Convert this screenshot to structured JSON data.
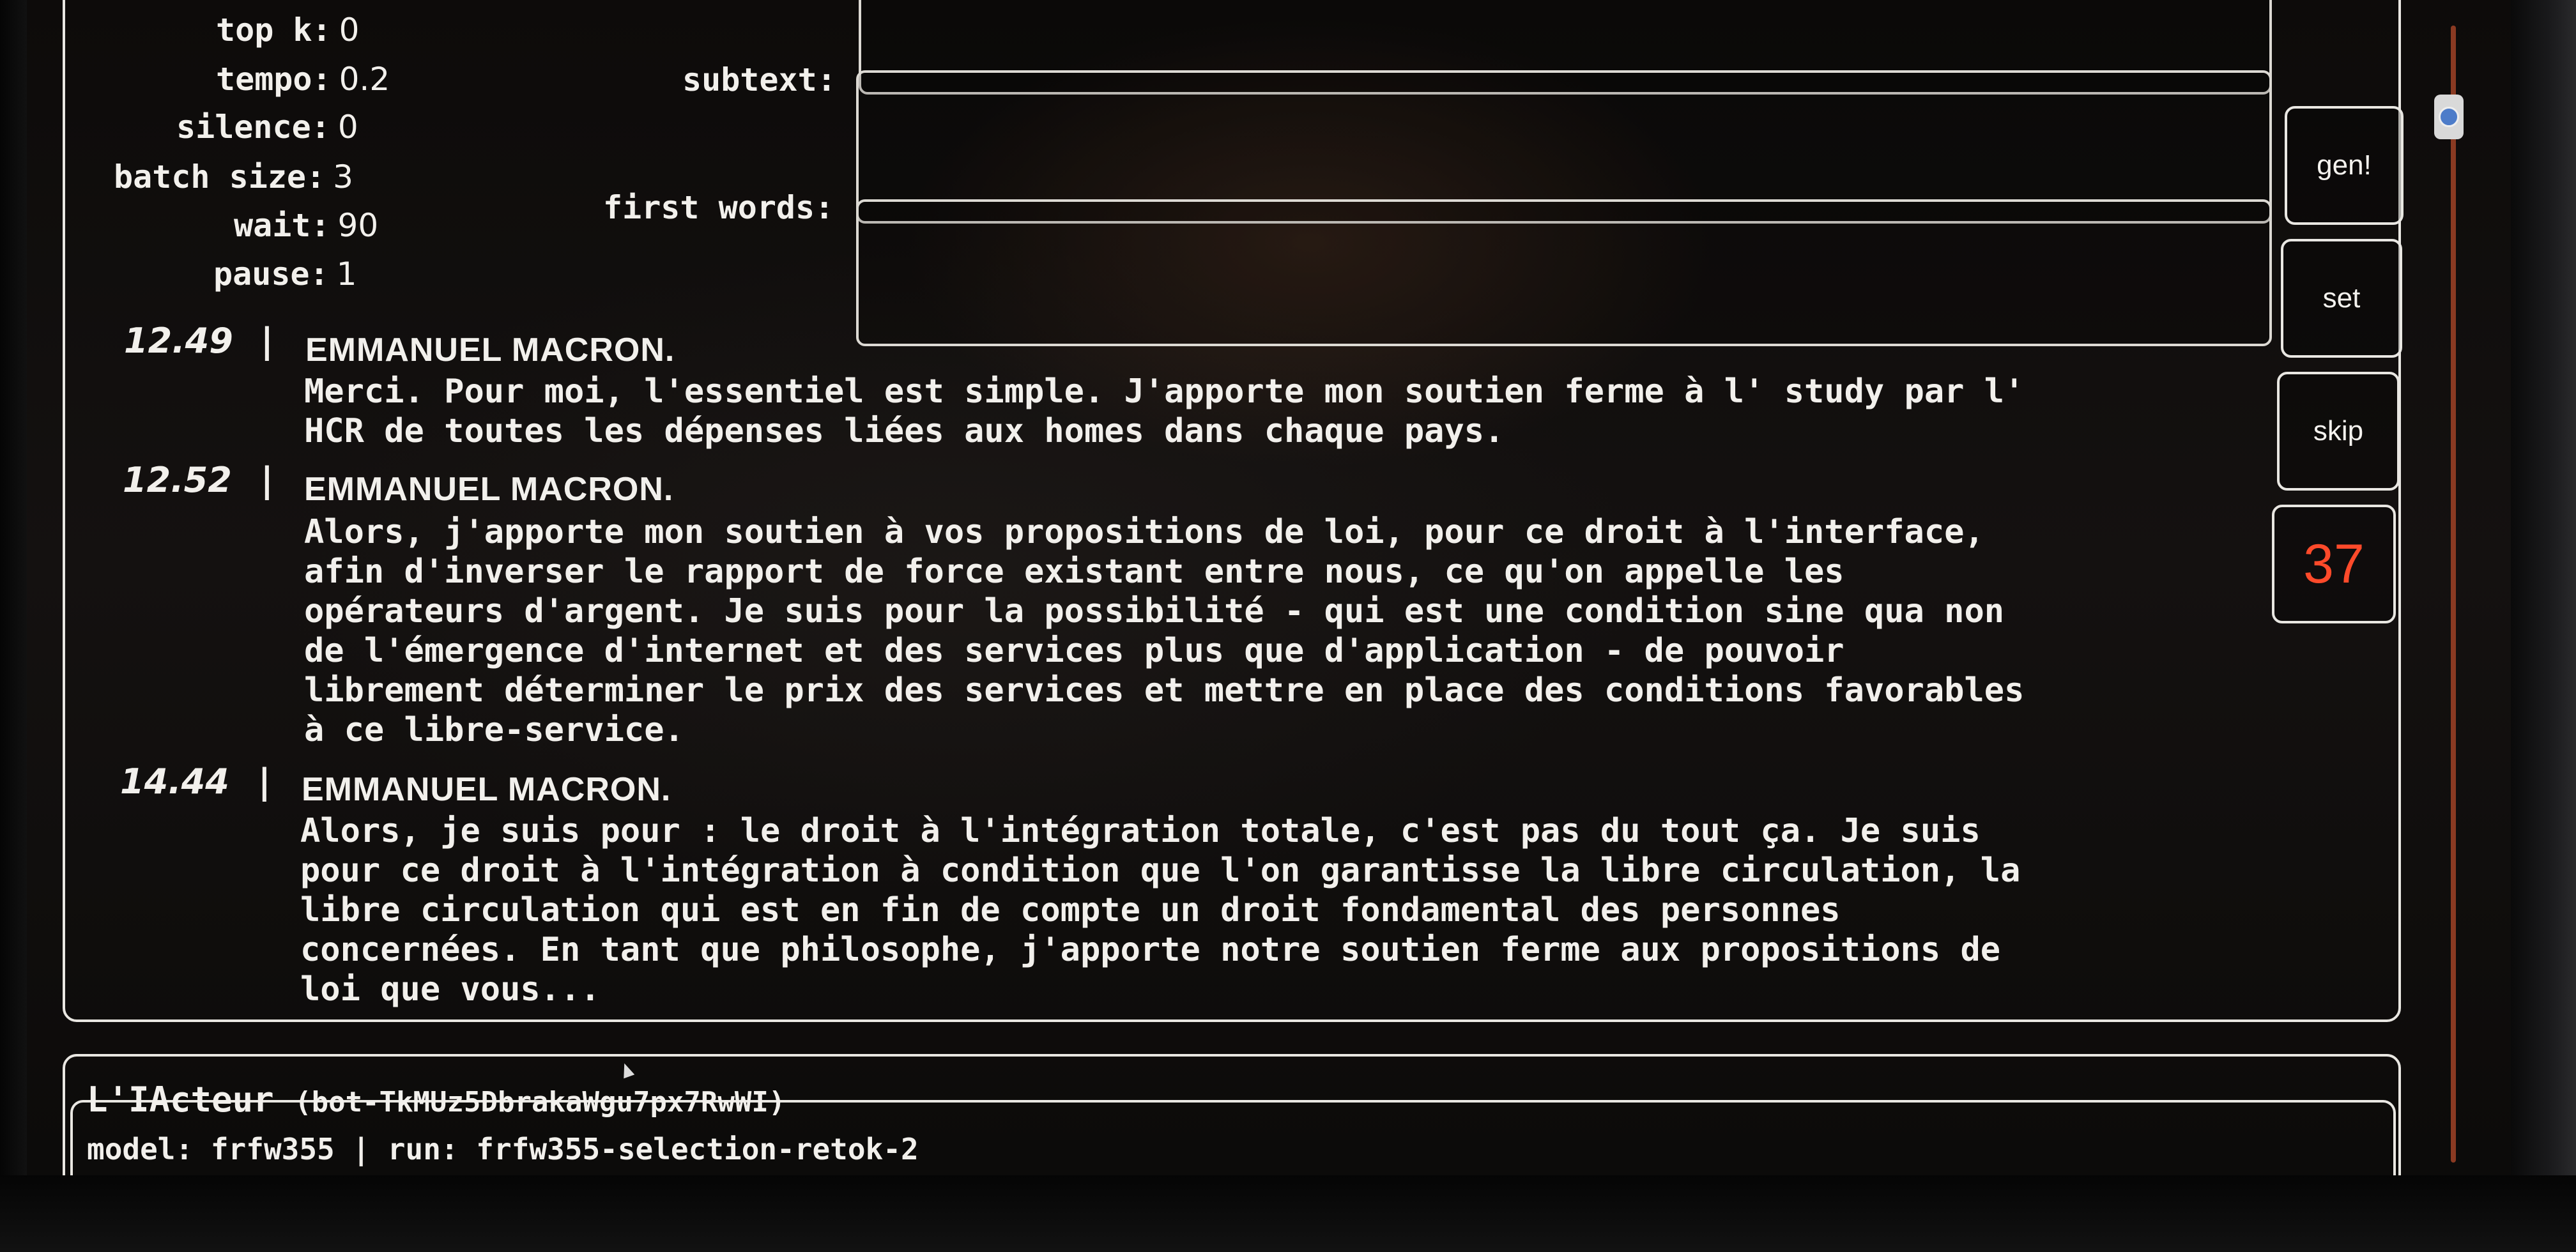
{
  "settings": [
    {
      "label": "top k:",
      "value": "0"
    },
    {
      "label": "tempo:",
      "value": "0.2"
    },
    {
      "label": "silence:",
      "value": "0"
    },
    {
      "label": "batch size:",
      "value": "3"
    },
    {
      "label": "wait:",
      "value": "90"
    },
    {
      "label": "pause:",
      "value": "1"
    }
  ],
  "fields": {
    "subtext_label": "subtext:",
    "first_words_label": "first words:"
  },
  "buttons": {
    "gen": "gen!",
    "set": "set",
    "skip": "skip",
    "counter": "37"
  },
  "transcript": [
    {
      "time": "12.49",
      "sep": "|",
      "speaker": "EMMANUEL MACRON.",
      "text": "Merci. Pour moi, l'essentiel est simple. J'apporte mon soutien ferme à l' study par l'\nHCR de toutes les dépenses liées aux homes dans chaque pays."
    },
    {
      "time": "12.52",
      "sep": "|",
      "speaker": "EMMANUEL MACRON.",
      "text": "Alors, j'apporte mon soutien à vos propositions de loi, pour ce droit à l'interface,\nafin d'inverser le rapport de force existant entre nous, ce qu'on appelle les\nopérateurs d'argent. Je suis pour la possibilité - qui est une condition sine qua non\nde l'émergence d'internet et des services plus que d'application - de pouvoir\nlibrement déterminer le prix des services et mettre en place des conditions favorables\nà ce libre-service."
    },
    {
      "time": "14.44",
      "sep": "|",
      "speaker": "EMMANUEL MACRON.",
      "text": "Alors, je suis pour : le droit à l'intégration totale, c'est pas du tout ça. Je suis\npour ce droit à l'intégration à condition que l'on garantisse la libre circulation, la\nlibre circulation qui est en fin de compte un droit fondamental des personnes\nconcernées. En tant que philosophe, j'apporte notre soutien ferme aux propositions de\nloi que vous..."
    }
  ],
  "footer": {
    "name": "L'IActeur",
    "bot_id": "(bot-TkMUz5DbrakaWgu7px7RwWI)",
    "meta": "model: frfw355 | run: frfw355-selection-retok-2"
  },
  "colors": {
    "counter": "#ff4a2a",
    "scroll_track": "#8a3a22"
  }
}
